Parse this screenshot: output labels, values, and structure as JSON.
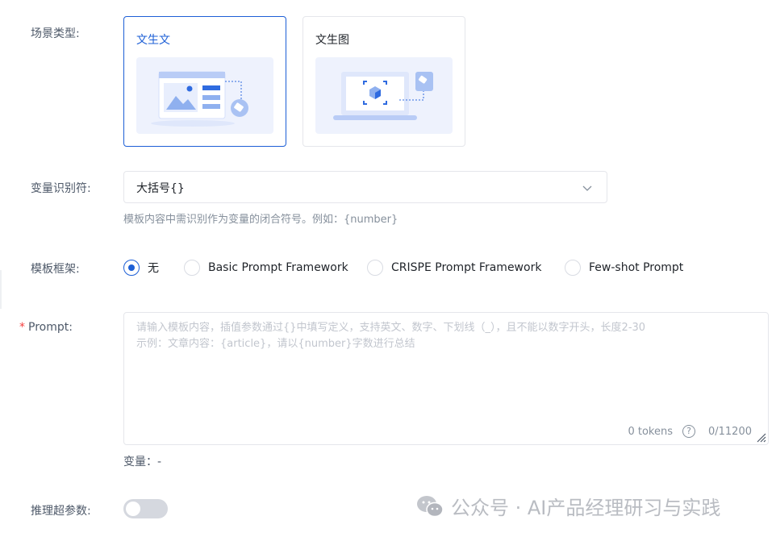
{
  "scene": {
    "label": "场景类型:",
    "options": [
      {
        "title": "文生文",
        "selected": true
      },
      {
        "title": "文生图",
        "selected": false
      }
    ]
  },
  "variable": {
    "label": "变量识别符:",
    "value": "大括号{}",
    "hint": "模板内容中需识别作为变量的闭合符号。例如：{number}"
  },
  "framework": {
    "label": "模板框架:",
    "options": [
      {
        "label": "无",
        "checked": true
      },
      {
        "label": "Basic Prompt Framework",
        "checked": false
      },
      {
        "label": "CRISPE Prompt Framework",
        "checked": false
      },
      {
        "label": "Few-shot Prompt",
        "checked": false
      }
    ]
  },
  "prompt": {
    "required_mark": "*",
    "label": "Prompt:",
    "placeholder": "请输入模板内容，插值参数通过{}中填写定义，支持英文、数字、下划线（_），且不能以数字开头，长度2-30\n示例：文章内容：{article}，请以{number}字数进行总结",
    "tokens": "0 tokens",
    "help": "?",
    "count": "0/11200"
  },
  "variables_line": "变量：-",
  "inference": {
    "label": "推理超参数:",
    "enabled": false
  },
  "watermark": "公众号 · AI产品经理研习与实践",
  "colors": {
    "primary": "#1d5fd6",
    "border": "#e5e6eb",
    "placeholder": "#c2c6ce",
    "hint": "#86909c"
  }
}
